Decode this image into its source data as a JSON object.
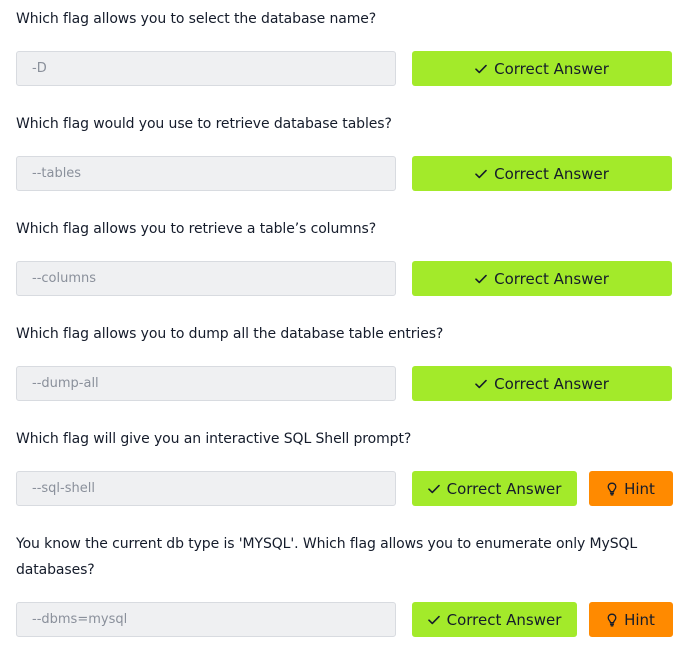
{
  "tasks": [
    {
      "question": "Which flag allows you to select the database name?",
      "answer": "-D",
      "submit_label": "Correct Answer"
    },
    {
      "question": "Which flag would you use to retrieve database tables?",
      "answer": "--tables",
      "submit_label": "Correct Answer"
    },
    {
      "question": "Which flag allows you to retrieve a table’s columns?",
      "answer": "--columns",
      "submit_label": "Correct Answer"
    },
    {
      "question": "Which flag allows you to dump all the database table entries?",
      "answer": "--dump-all",
      "submit_label": "Correct Answer"
    },
    {
      "question": "Which flag will give you an interactive SQL Shell prompt?",
      "answer": "--sql-shell",
      "submit_label": "Correct Answer",
      "hint_label": "Hint"
    },
    {
      "question": "You know the current db type is 'MYSQL'. Which flag allows you to enumerate only MySQL databases?",
      "answer": "--dbms=mysql",
      "submit_label": "Correct Answer",
      "hint_label": "Hint"
    }
  ],
  "icons": {
    "submit": "check-icon",
    "hint": "lightbulb-icon"
  },
  "colors": {
    "correct_button": "#a3ea2a",
    "hint_button": "#ff8a00",
    "input_background": "#eff0f2",
    "text": "#151c2b",
    "input_text": "#8a909b"
  }
}
